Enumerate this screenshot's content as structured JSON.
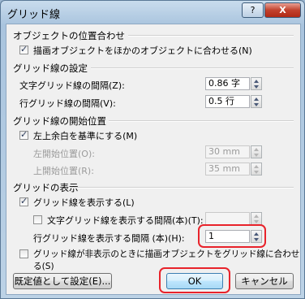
{
  "window": {
    "title": "グリッド線",
    "help": "?",
    "close": "X"
  },
  "object_position": {
    "heading": "オブジェクトの位置合わせ",
    "snap_label": "描画オブジェクトをほかのオブジェクトに合わせる(N)",
    "snap_checked": true
  },
  "grid_settings": {
    "heading": "グリッド線の設定",
    "char_spacing_label": "文字グリッド線の間隔(Z):",
    "char_spacing_value": "0.86 字",
    "line_spacing_label": "行グリッド線の間隔(V):",
    "line_spacing_value": "0.5 行"
  },
  "grid_origin": {
    "heading": "グリッド線の開始位置",
    "margin_label": "左上余白を基準にする(M)",
    "margin_checked": true,
    "horizontal_label": "左開始位置(O):",
    "horizontal_value": "30 mm",
    "vertical_label": "上開始位置(R):",
    "vertical_value": "35 mm"
  },
  "grid_display": {
    "heading": "グリッドの表示",
    "show_label": "グリッド線を表示する(L)",
    "show_checked": true,
    "vertical_every_label": "文字グリッド線を表示する間隔(本)(T):",
    "vertical_every_checked": false,
    "vertical_every_value": "",
    "horizontal_every_label": "行グリッド線を表示する間隔 (本)(H):",
    "horizontal_every_value": "1",
    "hidden_snap_label": "グリッド線が非表示のときに描画オブジェクトをグリッド線に合わせる(S)",
    "hidden_snap_checked": false
  },
  "buttons": {
    "default": "既定値として設定(E)...",
    "ok": "OK",
    "cancel": "キャンセル"
  },
  "colors": {
    "highlight": "#e8232b"
  }
}
